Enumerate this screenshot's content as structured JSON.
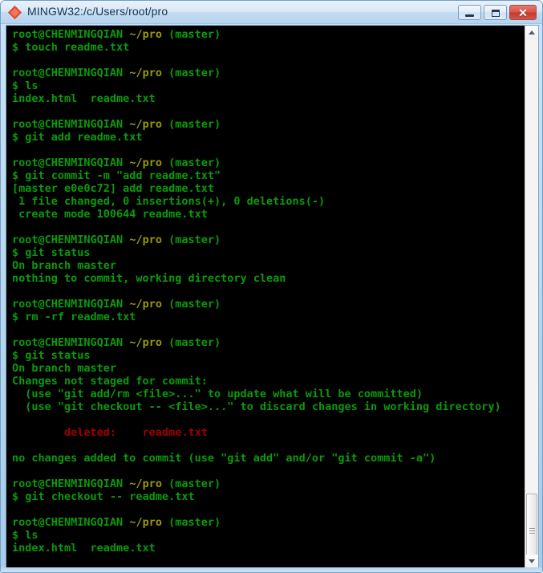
{
  "window": {
    "title": "MINGW32:/c/Users/root/pro",
    "app_icon": "git-diamond-icon",
    "controls": {
      "minimize_label": "–",
      "maximize_label": "□",
      "close_label": "✕"
    },
    "colors": {
      "title_bar_top": "#e8f2fb",
      "title_bar_bottom": "#b7d4ee",
      "frame": "#a8cbe8",
      "close_button": "#c3392f",
      "terminal_background": "#000000",
      "terminal_green": "#0b9a0b",
      "terminal_olive": "#9a9a00",
      "terminal_red": "#9c0000"
    }
  },
  "scrollbar": {
    "up_arrow": "scroll-up-arrow",
    "down_arrow": "scroll-down-arrow",
    "thumb_position_percent": 88
  },
  "terminal": {
    "user_host": "root@CHENMINGQIAN",
    "path": "~/pro",
    "branch": "(master)",
    "prompt_symbol": "$",
    "lines": [
      {
        "type": "prompt"
      },
      {
        "type": "command",
        "text": "$ touch readme.txt"
      },
      {
        "type": "blank"
      },
      {
        "type": "prompt"
      },
      {
        "type": "command",
        "text": "$ ls"
      },
      {
        "type": "output",
        "text": "index.html  readme.txt"
      },
      {
        "type": "blank"
      },
      {
        "type": "prompt"
      },
      {
        "type": "command",
        "text": "$ git add readme.txt"
      },
      {
        "type": "blank"
      },
      {
        "type": "prompt"
      },
      {
        "type": "command",
        "text": "$ git commit -m \"add readme.txt\""
      },
      {
        "type": "output",
        "text": "[master e0e0c72] add readme.txt"
      },
      {
        "type": "output",
        "text": " 1 file changed, 0 insertions(+), 0 deletions(-)"
      },
      {
        "type": "output",
        "text": " create mode 100644 readme.txt"
      },
      {
        "type": "blank"
      },
      {
        "type": "prompt"
      },
      {
        "type": "command",
        "text": "$ git status"
      },
      {
        "type": "output",
        "text": "On branch master"
      },
      {
        "type": "output",
        "text": "nothing to commit, working directory clean"
      },
      {
        "type": "blank"
      },
      {
        "type": "prompt"
      },
      {
        "type": "command",
        "text": "$ rm -rf readme.txt"
      },
      {
        "type": "blank"
      },
      {
        "type": "prompt"
      },
      {
        "type": "command",
        "text": "$ git status"
      },
      {
        "type": "output",
        "text": "On branch master"
      },
      {
        "type": "output",
        "text": "Changes not staged for commit:"
      },
      {
        "type": "output",
        "text": "  (use \"git add/rm <file>...\" to update what will be committed)"
      },
      {
        "type": "output",
        "text": "  (use \"git checkout -- <file>...\" to discard changes in working directory)"
      },
      {
        "type": "blank"
      },
      {
        "type": "deleted",
        "text": "        deleted:    readme.txt"
      },
      {
        "type": "blank"
      },
      {
        "type": "output",
        "text": "no changes added to commit (use \"git add\" and/or \"git commit -a\")"
      },
      {
        "type": "blank"
      },
      {
        "type": "prompt"
      },
      {
        "type": "command",
        "text": "$ git checkout -- readme.txt"
      },
      {
        "type": "blank"
      },
      {
        "type": "prompt"
      },
      {
        "type": "command",
        "text": "$ ls"
      },
      {
        "type": "output",
        "text": "index.html  readme.txt"
      }
    ]
  }
}
